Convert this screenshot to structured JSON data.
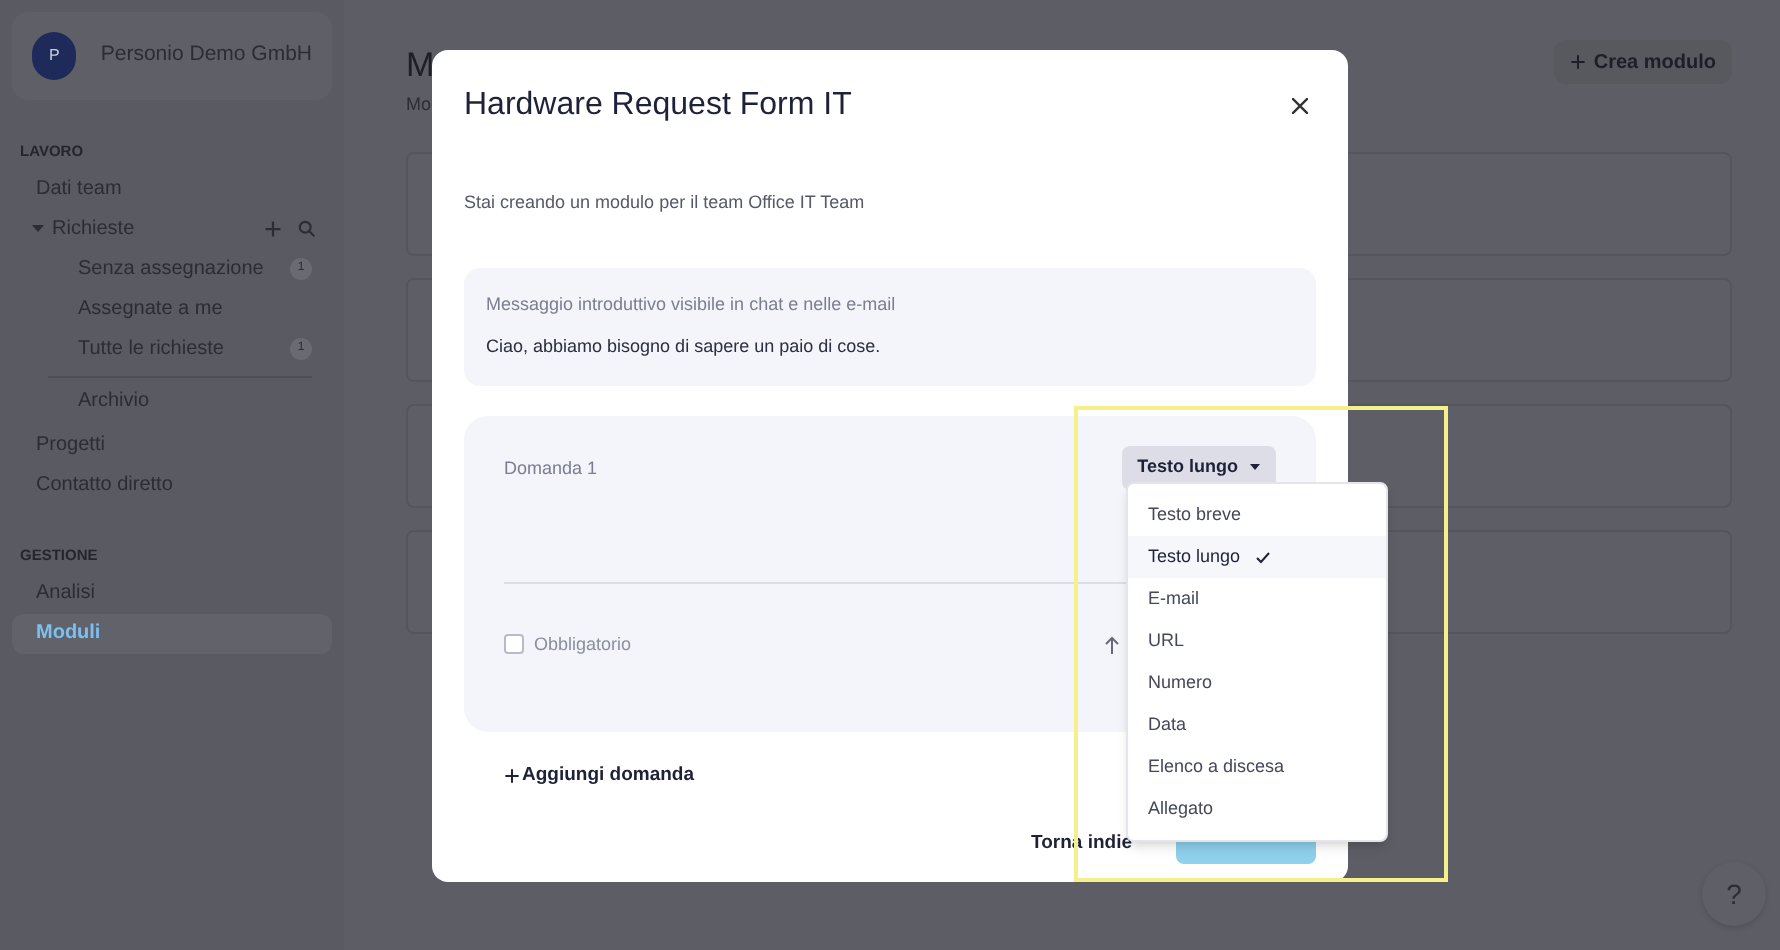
{
  "sidebar": {
    "company": {
      "avatar": "P",
      "name": "Personio Demo GmbH"
    },
    "sections": [
      {
        "heading": "LAVORO",
        "items": [
          {
            "label": "Dati team",
            "selected": false
          },
          {
            "label": "Richieste",
            "selected": false,
            "expanded": true,
            "children": [
              {
                "label": "Senza assegnazione",
                "badge": "1",
                "separated": false
              },
              {
                "label": "Assegnate a me",
                "separated": false
              },
              {
                "label": "Tutte le richieste",
                "badge": "1",
                "separated": false
              },
              {
                "label": "Archivio",
                "separated": true
              }
            ]
          },
          {
            "label": "Progetti",
            "selected": false
          },
          {
            "label": "Contatto diretto",
            "selected": false
          }
        ]
      },
      {
        "heading": "GESTIONE",
        "items": [
          {
            "label": "Analisi",
            "selected": false
          },
          {
            "label": "Moduli",
            "selected": true
          }
        ]
      }
    ]
  },
  "page": {
    "title": "M",
    "subtitle": "Mo",
    "create_button": "Crea modulo"
  },
  "modal": {
    "title": "Hardware Request Form IT",
    "intro": "Stai creando un modulo per il team Office IT Team",
    "message": {
      "label": "Messaggio introduttivo visibile in chat e nelle e-mail",
      "value": "Ciao, abbiamo bisogno di sapere un paio di cose."
    },
    "questions": [
      {
        "label": "Domanda 1",
        "type": "Testo lungo",
        "required": false,
        "required_label": "Obbligatorio"
      }
    ],
    "add_question": "Aggiungi domanda",
    "back_button": "Torna indie",
    "type_menu": [
      {
        "label": "Testo breve",
        "selected": false
      },
      {
        "label": "Testo lungo",
        "selected": true
      },
      {
        "label": "E-mail",
        "selected": false
      },
      {
        "label": "URL",
        "selected": false
      },
      {
        "label": "Numero",
        "selected": false
      },
      {
        "label": "Data",
        "selected": false
      },
      {
        "label": "Elenco a discesa",
        "selected": false
      },
      {
        "label": "Allegato",
        "selected": false
      }
    ]
  },
  "help_button": "?"
}
